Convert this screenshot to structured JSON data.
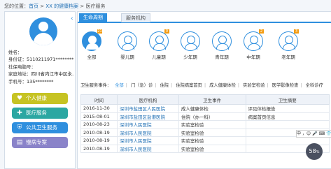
{
  "breadcrumb": {
    "prefix": "您的位置：",
    "home": "首页",
    "sep1": " > ",
    "owner": "XX 的健康档案",
    "sep2": " > ",
    "current": "医疗服务"
  },
  "patient": {
    "name_label": "姓名：",
    "name_value": "",
    "id_label": "身份证：",
    "id_value": "5110211971********",
    "residence_label": "社保电脑号：",
    "residence_value": "",
    "address_label": "家庭地址：",
    "address_value": "四川省内江市中区永...",
    "phone_label": "手机号：",
    "phone_value": "135********"
  },
  "left_nav": [
    {
      "label": "个人健康",
      "color": "#c6c323"
    },
    {
      "label": "医疗服务",
      "color": "#2ba7a2"
    },
    {
      "label": "公共卫生服务",
      "color": "#2f8fde"
    },
    {
      "label": "慢病专案",
      "color": "#8a83c9"
    }
  ],
  "tabs": {
    "active": "生命周期",
    "inactive": "服务机构"
  },
  "stages": [
    {
      "label": "全部",
      "badge": "21",
      "selected": true
    },
    {
      "label": "婴儿期",
      "badge": "",
      "selected": false
    },
    {
      "label": "儿童期",
      "badge": "0",
      "selected": false
    },
    {
      "label": "少年期",
      "badge": "",
      "selected": false
    },
    {
      "label": "青年期",
      "badge": "",
      "selected": false
    },
    {
      "label": "中年期",
      "badge": "2",
      "selected": false
    },
    {
      "label": "老年期",
      "badge": "3",
      "selected": false
    }
  ],
  "filter": {
    "label": "卫生服务事件：",
    "items": [
      "全部",
      "门（急）诊",
      "住院",
      "住院病案首页",
      "成人健康体检",
      "实验室检验",
      "医学影像检查",
      "全科诊疗"
    ]
  },
  "table": {
    "headers": [
      "时间",
      "医疗机构",
      "卫生事件",
      "卫生摘要"
    ],
    "rows": [
      [
        "2016-11-30",
        "深圳市盐田区人民医院",
        "成人健康体检",
        "评见体检报告"
      ],
      [
        "2015-08-01",
        "深圳市盐田区盐港医院",
        "住院（办一科）",
        "病案首页信息"
      ],
      [
        "2010-08-23",
        "深圳市人民医院",
        "实验室检验",
        ""
      ],
      [
        "2010-08-19",
        "深圳市人民医院",
        "实验室检验",
        ""
      ],
      [
        "2010-08-19",
        "深圳市人民医院",
        "实验室检验",
        ""
      ],
      [
        "2010-08-19",
        "深圳市人民医院",
        "实验室检验",
        ""
      ]
    ]
  },
  "overlay": {
    "ime_text": "中 ，☺ 🎤 ⌨ 👕 ⚙",
    "speed_value": "58",
    "speed_unit": "%"
  }
}
